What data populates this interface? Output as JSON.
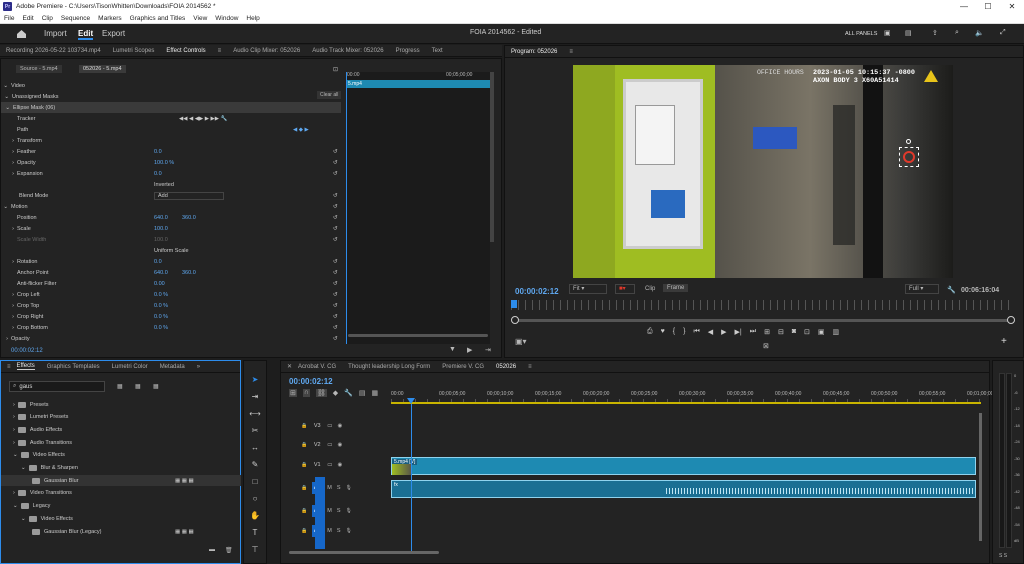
{
  "titlebar": {
    "app_icon": "Pr",
    "title": "Adobe Premiere - C:\\Users\\TisonWhitten\\Downloads\\FOIA 2014562 *",
    "min": "—",
    "max": "☐",
    "close": "✕"
  },
  "menu": [
    "File",
    "Edit",
    "Clip",
    "Sequence",
    "Markers",
    "Graphics and Titles",
    "View",
    "Window",
    "Help"
  ],
  "workspace": {
    "tabs": [
      "Import",
      "Edit",
      "Export"
    ],
    "active": "Edit",
    "project": "FOIA 2014562 - Edited",
    "all_panels": "ALL PANELS"
  },
  "top_tabs": [
    "Recording 2026-05-22 103734.mp4",
    "Lumetri Scopes",
    "Effect Controls",
    "Audio Clip Mixer: 052026",
    "Audio Track Mixer: 052026",
    "Progress",
    "Text"
  ],
  "effect_controls": {
    "source": "Source - 5.mp4",
    "seq": "052026 - 5.mp4",
    "clip_label": "5.mp4",
    "clear_all": "Clear all",
    "ruler_start": "00:00",
    "ruler_end": "00;05;00;00",
    "timecode": "00:00:02:12",
    "rows": [
      {
        "label": "Video",
        "value": "",
        "value2": ""
      },
      {
        "label": "Unassigned Masks",
        "value": "",
        "value2": ""
      },
      {
        "label": "Ellipse Mask (06)",
        "value": "",
        "value2": ""
      },
      {
        "label": "Tracker",
        "value": "",
        "value2": ""
      },
      {
        "label": "Path",
        "value": "",
        "value2": ""
      },
      {
        "label": "Transform",
        "value": "",
        "value2": ""
      },
      {
        "label": "Feather",
        "value": "0.0",
        "value2": ""
      },
      {
        "label": "Opacity",
        "value": "100.0 %",
        "value2": ""
      },
      {
        "label": "Expansion",
        "value": "0.0",
        "value2": ""
      },
      {
        "label": "",
        "value": "Inverted",
        "value2": ""
      },
      {
        "label": "Blend Mode",
        "value": "Add",
        "value2": ""
      },
      {
        "label": "Motion",
        "value": "",
        "value2": ""
      },
      {
        "label": "Position",
        "value": "640.0",
        "value2": "360.0"
      },
      {
        "label": "Scale",
        "value": "100.0",
        "value2": ""
      },
      {
        "label": "Scale Width",
        "value": "100.0",
        "value2": ""
      },
      {
        "label": "",
        "value": "Uniform Scale",
        "value2": ""
      },
      {
        "label": "Rotation",
        "value": "0.0",
        "value2": ""
      },
      {
        "label": "Anchor Point",
        "value": "640.0",
        "value2": "360.0"
      },
      {
        "label": "Anti-flicker Filter",
        "value": "0.00",
        "value2": ""
      },
      {
        "label": "Crop Left",
        "value": "0.0 %",
        "value2": ""
      },
      {
        "label": "Crop Top",
        "value": "0.0 %",
        "value2": ""
      },
      {
        "label": "Crop Right",
        "value": "0.0 %",
        "value2": ""
      },
      {
        "label": "Crop Bottom",
        "value": "0.0 %",
        "value2": ""
      },
      {
        "label": "Opacity",
        "value": "",
        "value2": ""
      }
    ]
  },
  "program": {
    "title": "Program: 052026",
    "timecode": "00:00:02:12",
    "fit": "Fit",
    "clip": "Clip",
    "frame": "Frame",
    "full": "Full",
    "duration": "00:06:16:04",
    "overlay_time": "2023-01-05 10:15:37 -0800",
    "overlay_cam": "AXON BODY 3 X60A51414",
    "sign": "OFFICE HOURS"
  },
  "effects_panel": {
    "tabs": [
      "Effects",
      "Graphics Templates",
      "Lumetri Color",
      "Metadata"
    ],
    "search": "gaus",
    "tree": [
      {
        "label": "Presets",
        "indent": 0
      },
      {
        "label": "Lumetri Presets",
        "indent": 0
      },
      {
        "label": "Audio Effects",
        "indent": 0
      },
      {
        "label": "Audio Transitions",
        "indent": 0
      },
      {
        "label": "Video Effects",
        "indent": 0
      },
      {
        "label": "Blur & Sharpen",
        "indent": 1
      },
      {
        "label": "Gaussian Blur",
        "indent": 2
      },
      {
        "label": "Video Transitions",
        "indent": 0
      },
      {
        "label": "Legacy",
        "indent": 0
      },
      {
        "label": "Video Effects",
        "indent": 1
      },
      {
        "label": "Gaussian Blur (Legacy)",
        "indent": 2
      }
    ]
  },
  "timeline": {
    "tabs": [
      "Acrobat V. CG",
      "Thought leadership Long Form",
      "Premiere V. CG",
      "052026"
    ],
    "timecode": "00:00:02:12",
    "ruler": [
      "00:00",
      "00;00;05;00",
      "00;00;10;00",
      "00;00;15;00",
      "00;00;20;00",
      "00;00;25;00",
      "00;00;30;00",
      "00;00;35;00",
      "00;00;40;00",
      "00;00;45;00",
      "00;00;50;00",
      "00;00;55;00",
      "00;01;00;00"
    ],
    "tracks": [
      "V3",
      "V2",
      "V1",
      "A1",
      "A2",
      "A3"
    ],
    "video_clip": "5.mp4 [V]",
    "audio_tag": "fx",
    "meter": [
      "0",
      "-6",
      "-12",
      "-18",
      "-24",
      "-30",
      "-36",
      "-42",
      "-48",
      "-54",
      "dB"
    ],
    "meter_bottom": "S S"
  },
  "colors": {
    "accent": "#2d8ceb",
    "clip": "#1e8ab2",
    "track_badge": "#1667c9"
  }
}
